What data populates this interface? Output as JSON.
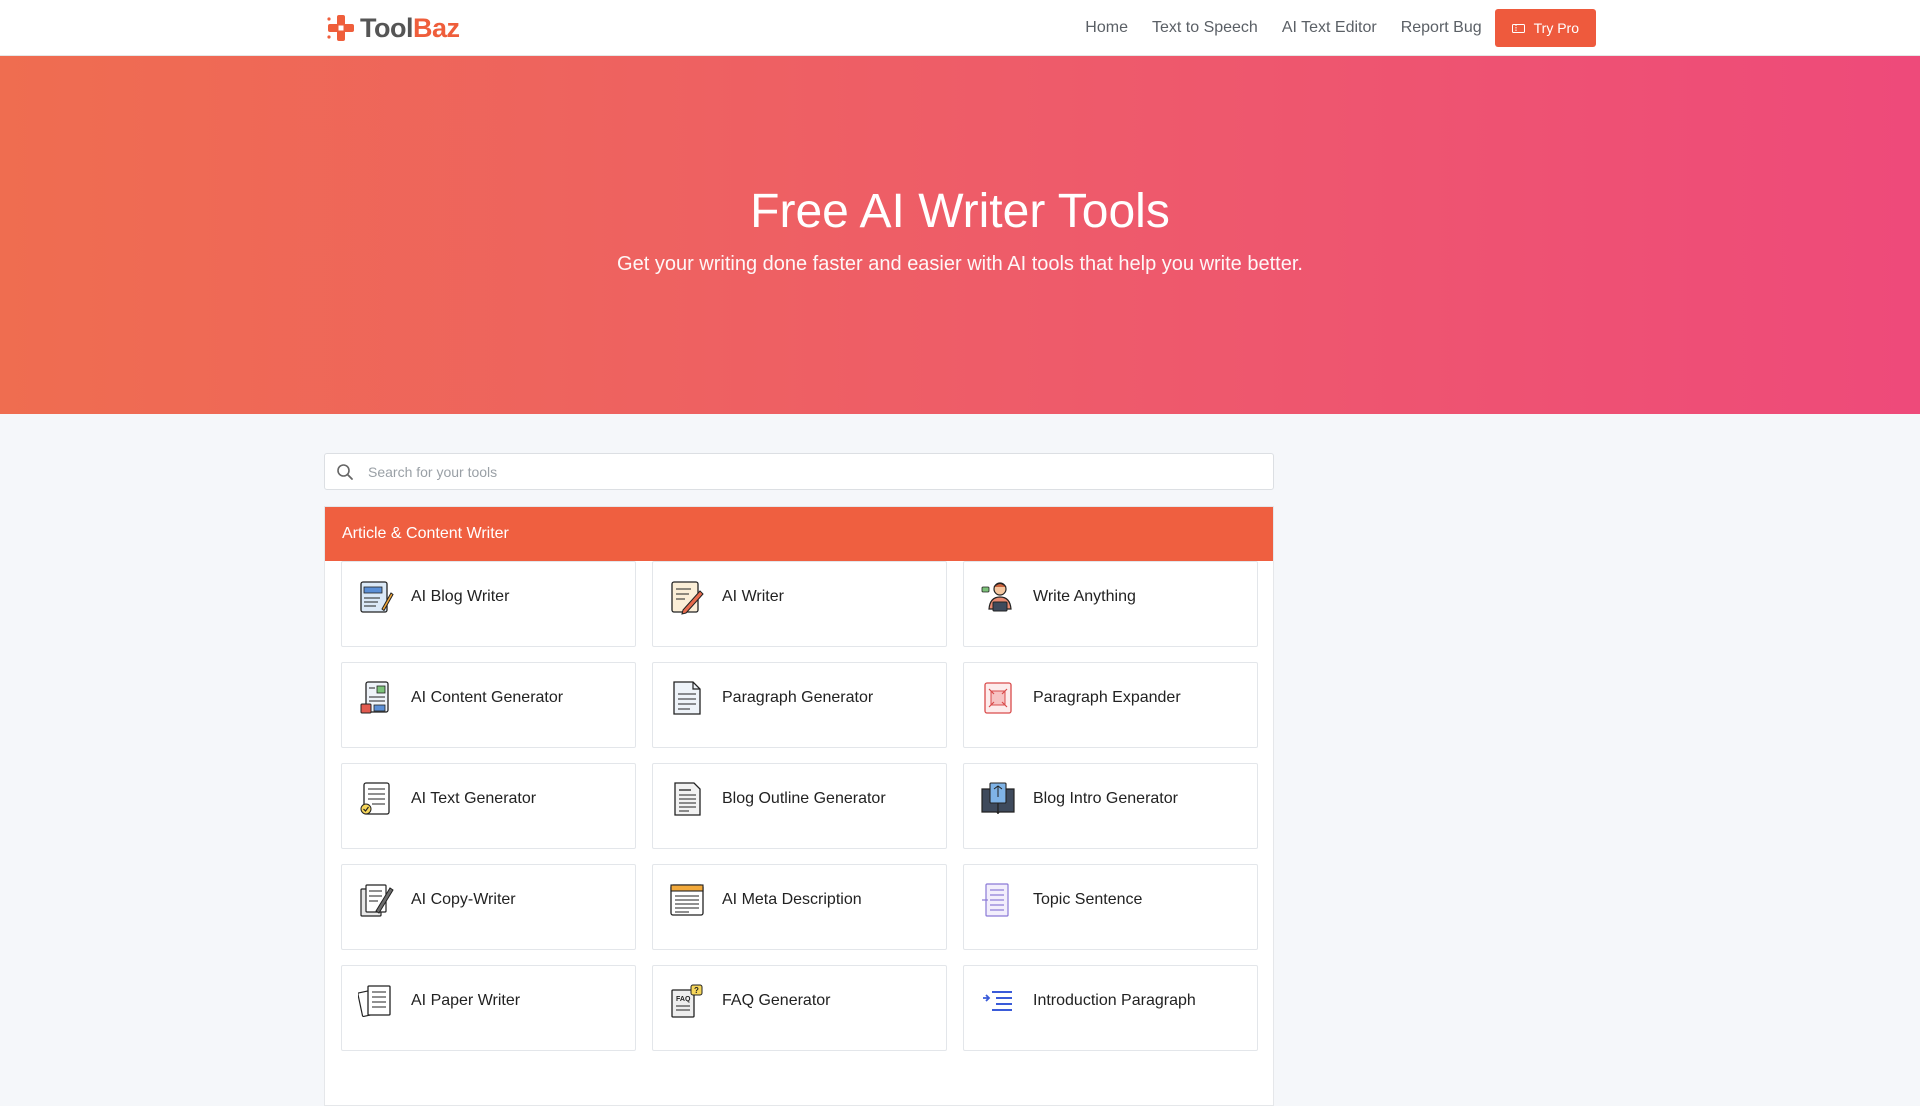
{
  "brand": {
    "name_part1": "Tool",
    "name_part2": "Baz",
    "logo_icon": "plus-cross-logo"
  },
  "nav": {
    "links": [
      "Home",
      "Text to Speech",
      "AI Text Editor",
      "Report Bug"
    ],
    "cta_label": "Try Pro",
    "cta_icon": "ticket-icon"
  },
  "hero": {
    "title": "Free AI Writer Tools",
    "subtitle": "Get your writing done faster and easier with AI tools that help you write better."
  },
  "search": {
    "placeholder": "Search for your tools"
  },
  "category": {
    "title": "Article & Content Writer",
    "tools": [
      {
        "label": "AI Blog Writer",
        "icon": "blog-icon"
      },
      {
        "label": "AI Writer",
        "icon": "writer-icon"
      },
      {
        "label": "Write Anything",
        "icon": "person-laptop-icon"
      },
      {
        "label": "AI Content Generator",
        "icon": "content-generator-icon"
      },
      {
        "label": "Paragraph Generator",
        "icon": "paragraph-icon"
      },
      {
        "label": "Paragraph Expander",
        "icon": "expand-icon"
      },
      {
        "label": "AI Text Generator",
        "icon": "text-generator-icon"
      },
      {
        "label": "Blog Outline Generator",
        "icon": "outline-icon"
      },
      {
        "label": "Blog Intro Generator",
        "icon": "book-icon"
      },
      {
        "label": "AI Copy-Writer",
        "icon": "copywriter-icon"
      },
      {
        "label": "AI Meta Description",
        "icon": "meta-icon"
      },
      {
        "label": "Topic Sentence",
        "icon": "topic-icon"
      },
      {
        "label": "AI Paper Writer",
        "icon": "papers-icon"
      },
      {
        "label": "FAQ Generator",
        "icon": "faq-icon"
      },
      {
        "label": "Introduction Paragraph",
        "icon": "intro-icon"
      }
    ]
  },
  "colors": {
    "accent": "#ee5a3d",
    "hero_start": "#ef6d50",
    "hero_end": "#ee4a7a"
  }
}
